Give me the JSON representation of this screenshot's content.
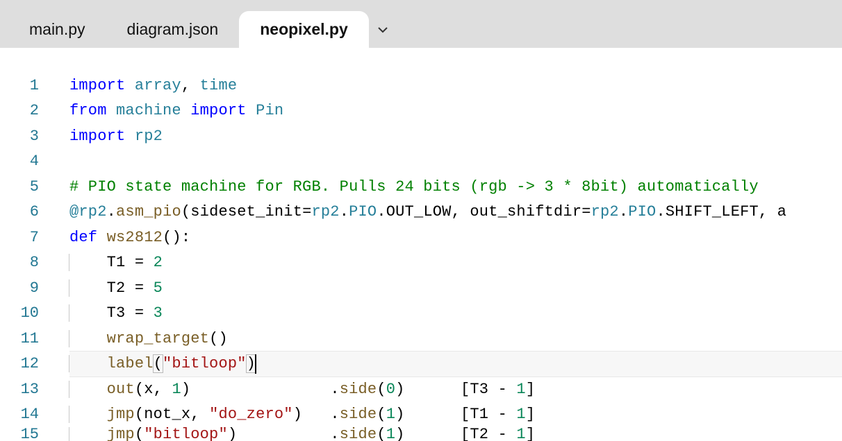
{
  "tabs": [
    {
      "label": "main.py",
      "active": false
    },
    {
      "label": "diagram.json",
      "active": false
    },
    {
      "label": "neopixel.py",
      "active": true
    }
  ],
  "gutter": {
    "l1": "1",
    "l2": "2",
    "l3": "3",
    "l4": "4",
    "l5": "5",
    "l6": "6",
    "l7": "7",
    "l8": "8",
    "l9": "9",
    "l10": "10",
    "l11": "11",
    "l12": "12",
    "l13": "13",
    "l14": "14",
    "l15": "15"
  },
  "tok": {
    "import": "import",
    "from": "from",
    "def": "def",
    "array": "array",
    "time": "time",
    "machine": "machine",
    "Pin": "Pin",
    "rp2": "rp2",
    "comment5": "# PIO state machine for RGB. Pulls 24 bits (rgb -> 3 * 8bit) automatically",
    "at": "@",
    "rp2mod": "rp2",
    "asm_pio": "asm_pio",
    "sideset_init": "sideset_init",
    "PIO": "PIO",
    "OUT_LOW": "OUT_LOW",
    "out_shiftdir": "out_shiftdir",
    "SHIFT_LEFT": "SHIFT_LEFT",
    "ws2812": "ws2812",
    "T1": "T1",
    "T2": "T2",
    "T3": "T3",
    "n2": "2",
    "n5": "5",
    "n3": "3",
    "n0": "0",
    "n1": "1",
    "wrap_target": "wrap_target",
    "label": "label",
    "bitloop": "\"bitloop\"",
    "out": "out",
    "x": "x",
    "side": "side",
    "jmp": "jmp",
    "not_x": "not_x",
    "do_zero": "\"do_zero\"",
    "comma": ", ",
    "eq": " = ",
    "dot": ".",
    "lp": "(",
    "rp": ")",
    "lb": "[",
    "rb": "]",
    "minus": " - ",
    "colon": ":",
    "trailA": ", a",
    "sp13a": "               ",
    "sp13b": "      ",
    "sp14a": "   ",
    "sp14b": "      ",
    "sp15a": "          ",
    "sp15b": "      "
  }
}
